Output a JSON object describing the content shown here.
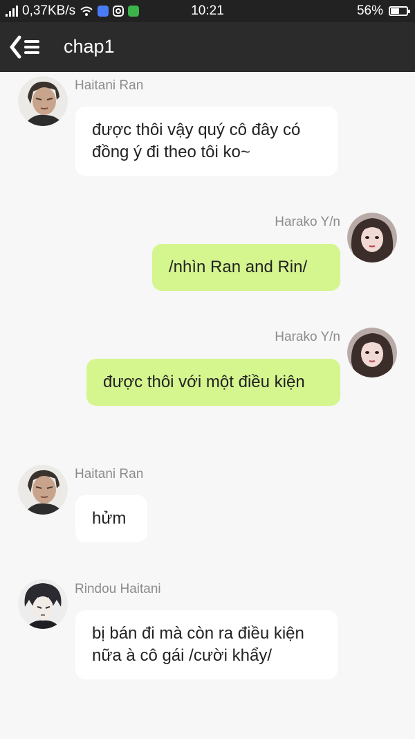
{
  "status_bar": {
    "network_speed": "0,37KB/s",
    "time": "10:21",
    "battery_percent": "56%",
    "battery_level": 0.56,
    "colors": {
      "app1": "#4a7bf7",
      "app3": "#3bb54a"
    }
  },
  "app_bar": {
    "title": "chap1",
    "back_icon": "back-list-icon"
  },
  "messages": [
    {
      "sender": "Haitani Ran",
      "text": "được thôi vậy quý cô đây có đồng ý đi theo tôi ko~"
    },
    {
      "sender": "Harako Y/n",
      "text": "/nhìn Ran and Rin/"
    },
    {
      "sender": "Harako Y/n",
      "text": "được thôi với một điều kiện"
    },
    {
      "sender": "Haitani Ran",
      "text": "hửm"
    },
    {
      "sender": "Rindou Haitani",
      "text": "bị bán đi mà còn ra điều kiện nữa à cô gái /cười khẩy/"
    }
  ],
  "colors": {
    "incoming_bubble": "#ffffff",
    "outgoing_bubble": "#d5f58f",
    "app_bar": "#2b2b2b"
  }
}
